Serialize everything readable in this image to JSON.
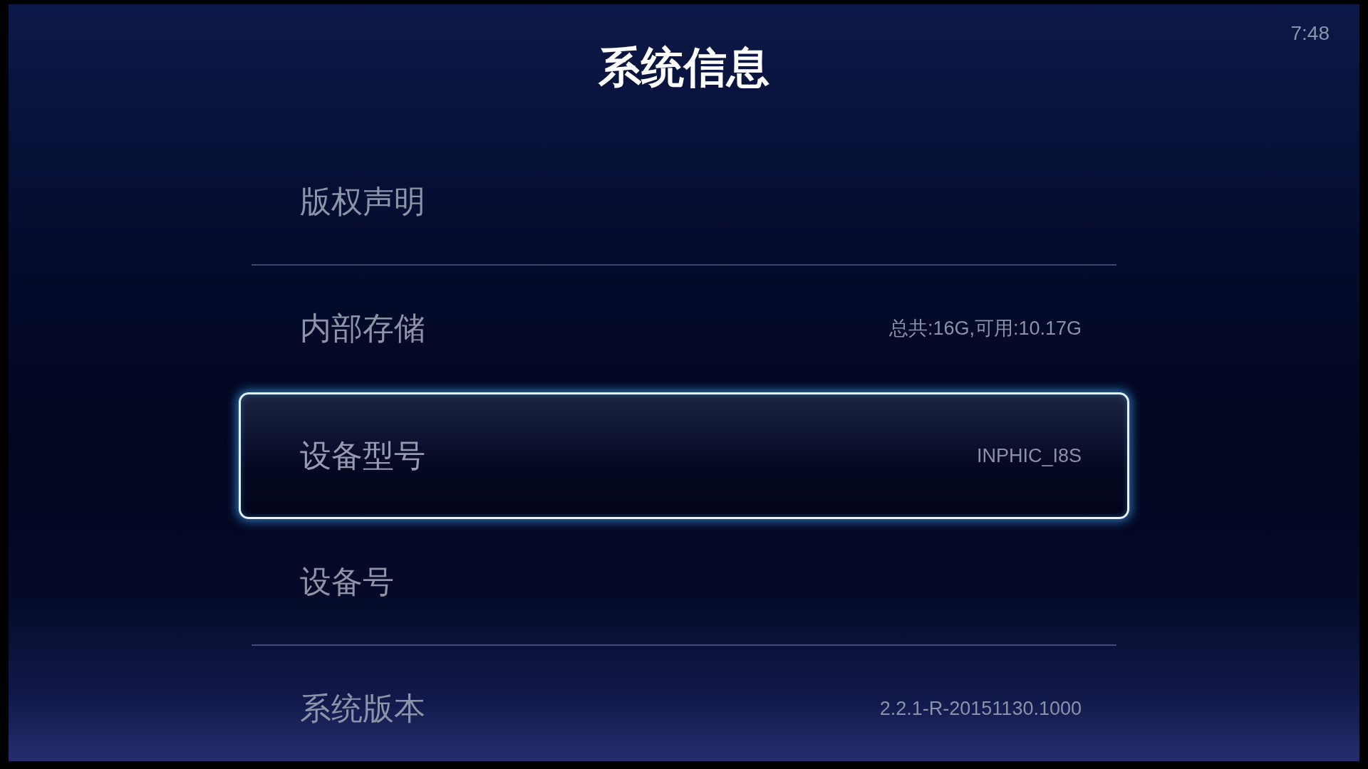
{
  "screen": {
    "title": "系统信息",
    "clock": "7:48"
  },
  "items": [
    {
      "label": "版权声明",
      "selected": false
    },
    {
      "label": "内部存储",
      "value": "总共:16G,可用:10.17G",
      "selected": false
    },
    {
      "label": "设备型号",
      "value": "INPHIC_I8S",
      "selected": true
    },
    {
      "label": "设备号",
      "selected": false
    },
    {
      "label": "系统版本",
      "value": "2.2.1-R-20151130.1000",
      "selected": false
    }
  ]
}
